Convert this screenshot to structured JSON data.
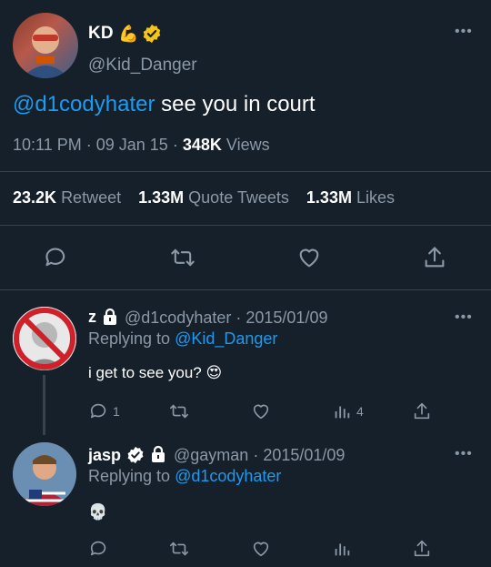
{
  "main_tweet": {
    "name": "KD",
    "handle": "@Kid_Danger",
    "mention": "@d1codyhater",
    "text": " see you in court",
    "time": "10:11 PM",
    "date": "09 Jan 15",
    "views_count": "348K",
    "views_label": "Views",
    "retweets": "23.2K",
    "retweets_label": "Retweet",
    "quotes": "1.33M",
    "quotes_label": "Quote Tweets",
    "likes": "1.33M",
    "likes_label": "Likes",
    "emoji": "💪"
  },
  "replies": [
    {
      "name": "z",
      "handle": "@d1codyhater",
      "date": "2015/01/09",
      "replying_to_label": "Replying to",
      "replying_to": "@Kid_Danger",
      "text": "i get to see you?",
      "emoji": "😍",
      "reply_count": "1",
      "views_count": "4"
    },
    {
      "name": "jasp",
      "handle": "@gayman",
      "date": "2015/01/09",
      "replying_to_label": "Replying to",
      "replying_to": "@d1codyhater",
      "emoji": "💀"
    }
  ],
  "more": "•••",
  "separator": "·",
  "colors": {
    "background": "#15202b",
    "accent": "#1d9bf0",
    "muted": "#8b98a5",
    "divider": "#38444d",
    "verified": "#f5c518"
  }
}
